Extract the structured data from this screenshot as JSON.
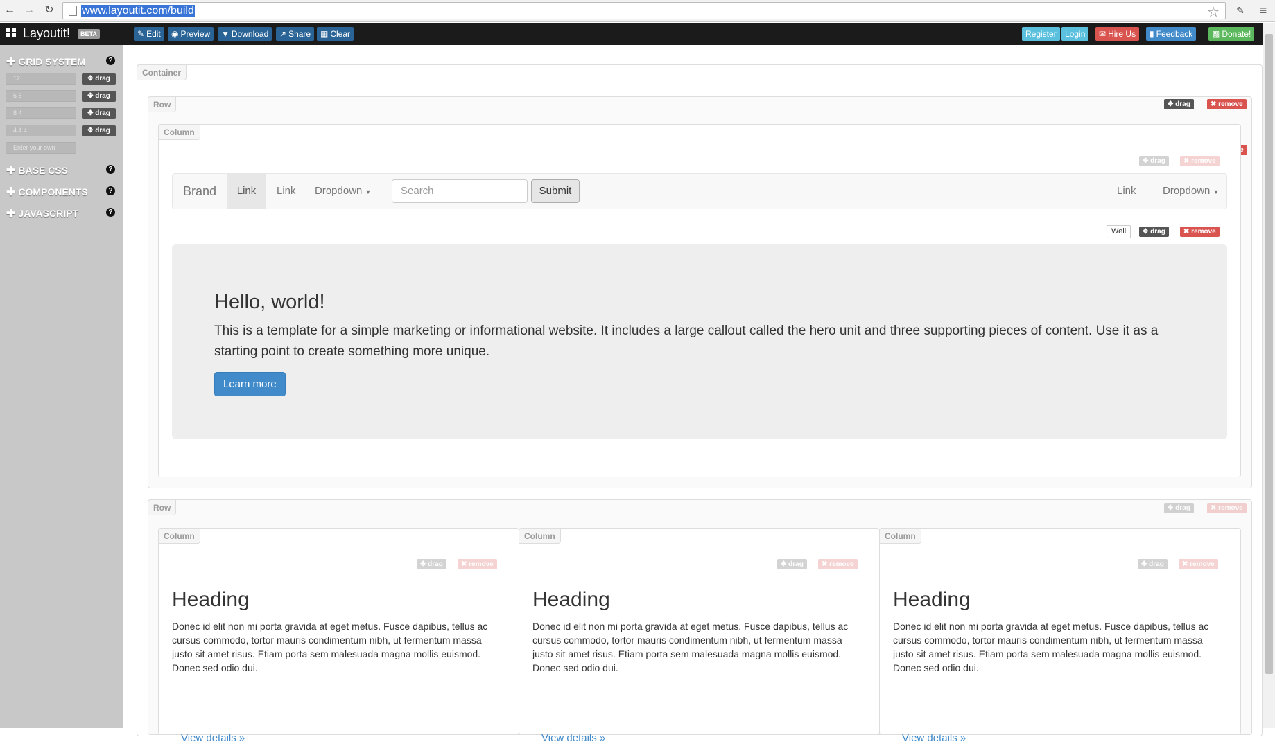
{
  "browser": {
    "url": "www.layoutit.com/build",
    "back_icon": "back-arrow-icon",
    "forward_icon": "forward-arrow-icon",
    "reload_icon": "reload-icon"
  },
  "app": {
    "brand": "Layoutit!",
    "badge": "BETA",
    "toolbar": [
      {
        "icon": "edit-icon",
        "label": "Edit"
      },
      {
        "icon": "eye-icon",
        "label": "Preview"
      },
      {
        "icon": "download-icon",
        "label": "Download"
      },
      {
        "icon": "share-icon",
        "label": "Share"
      },
      {
        "icon": "trash-icon",
        "label": "Clear"
      }
    ],
    "right_buttons": [
      {
        "label": "Register",
        "color": "#5bc0de"
      },
      {
        "label": "Login",
        "color": "#5bc0de"
      },
      {
        "label": "Hire Us",
        "color": "#d9534f"
      },
      {
        "label": "Feedback",
        "color": "#428bca"
      },
      {
        "label": "Donate!",
        "color": "#5cb85c"
      }
    ]
  },
  "sidebar": {
    "sections": [
      {
        "label": "GRID SYSTEM"
      },
      {
        "label": "BASE CSS"
      },
      {
        "label": "COMPONENTS"
      },
      {
        "label": "JAVASCRIPT"
      }
    ],
    "grid_rows": [
      "12",
      "6 6",
      "8 4",
      "4 4 4"
    ],
    "grid_custom_placeholder": "Enter your own",
    "drag_label": "drag"
  },
  "canvas": {
    "container_label": "Container",
    "row_label": "Row",
    "column_label": "Column",
    "drag_label": "drag",
    "remove_label": "remove",
    "well_label": "Well",
    "navbar": {
      "brand": "Brand",
      "links": [
        "Link",
        "Link"
      ],
      "dropdown": "Dropdown",
      "search_placeholder": "Search",
      "submit": "Submit",
      "right_link": "Link",
      "right_dropdown": "Dropdown"
    },
    "hero": {
      "title": "Hello, world!",
      "text": "This is a template for a simple marketing or informational website. It includes a large callout called the hero unit and three supporting pieces of content. Use it as a starting point to create something more unique.",
      "button": "Learn more"
    },
    "columns": [
      {
        "heading": "Heading",
        "text": "Donec id elit non mi porta gravida at eget metus. Fusce dapibus, tellus ac cursus commodo, tortor mauris condimentum nibh, ut fermentum massa justo sit amet risus. Etiam porta sem malesuada magna mollis euismod. Donec sed odio dui.",
        "link": "View details »"
      },
      {
        "heading": "Heading",
        "text": "Donec id elit non mi porta gravida at eget metus. Fusce dapibus, tellus ac cursus commodo, tortor mauris condimentum nibh, ut fermentum massa justo sit amet risus. Etiam porta sem malesuada magna mollis euismod. Donec sed odio dui.",
        "link": "View details »"
      },
      {
        "heading": "Heading",
        "text": "Donec id elit non mi porta gravida at eget metus. Fusce dapibus, tellus ac cursus commodo, tortor mauris condimentum nibh, ut fermentum massa justo sit amet risus. Etiam porta sem malesuada magna mollis euismod. Donec sed odio dui.",
        "link": "View details »"
      }
    ]
  }
}
